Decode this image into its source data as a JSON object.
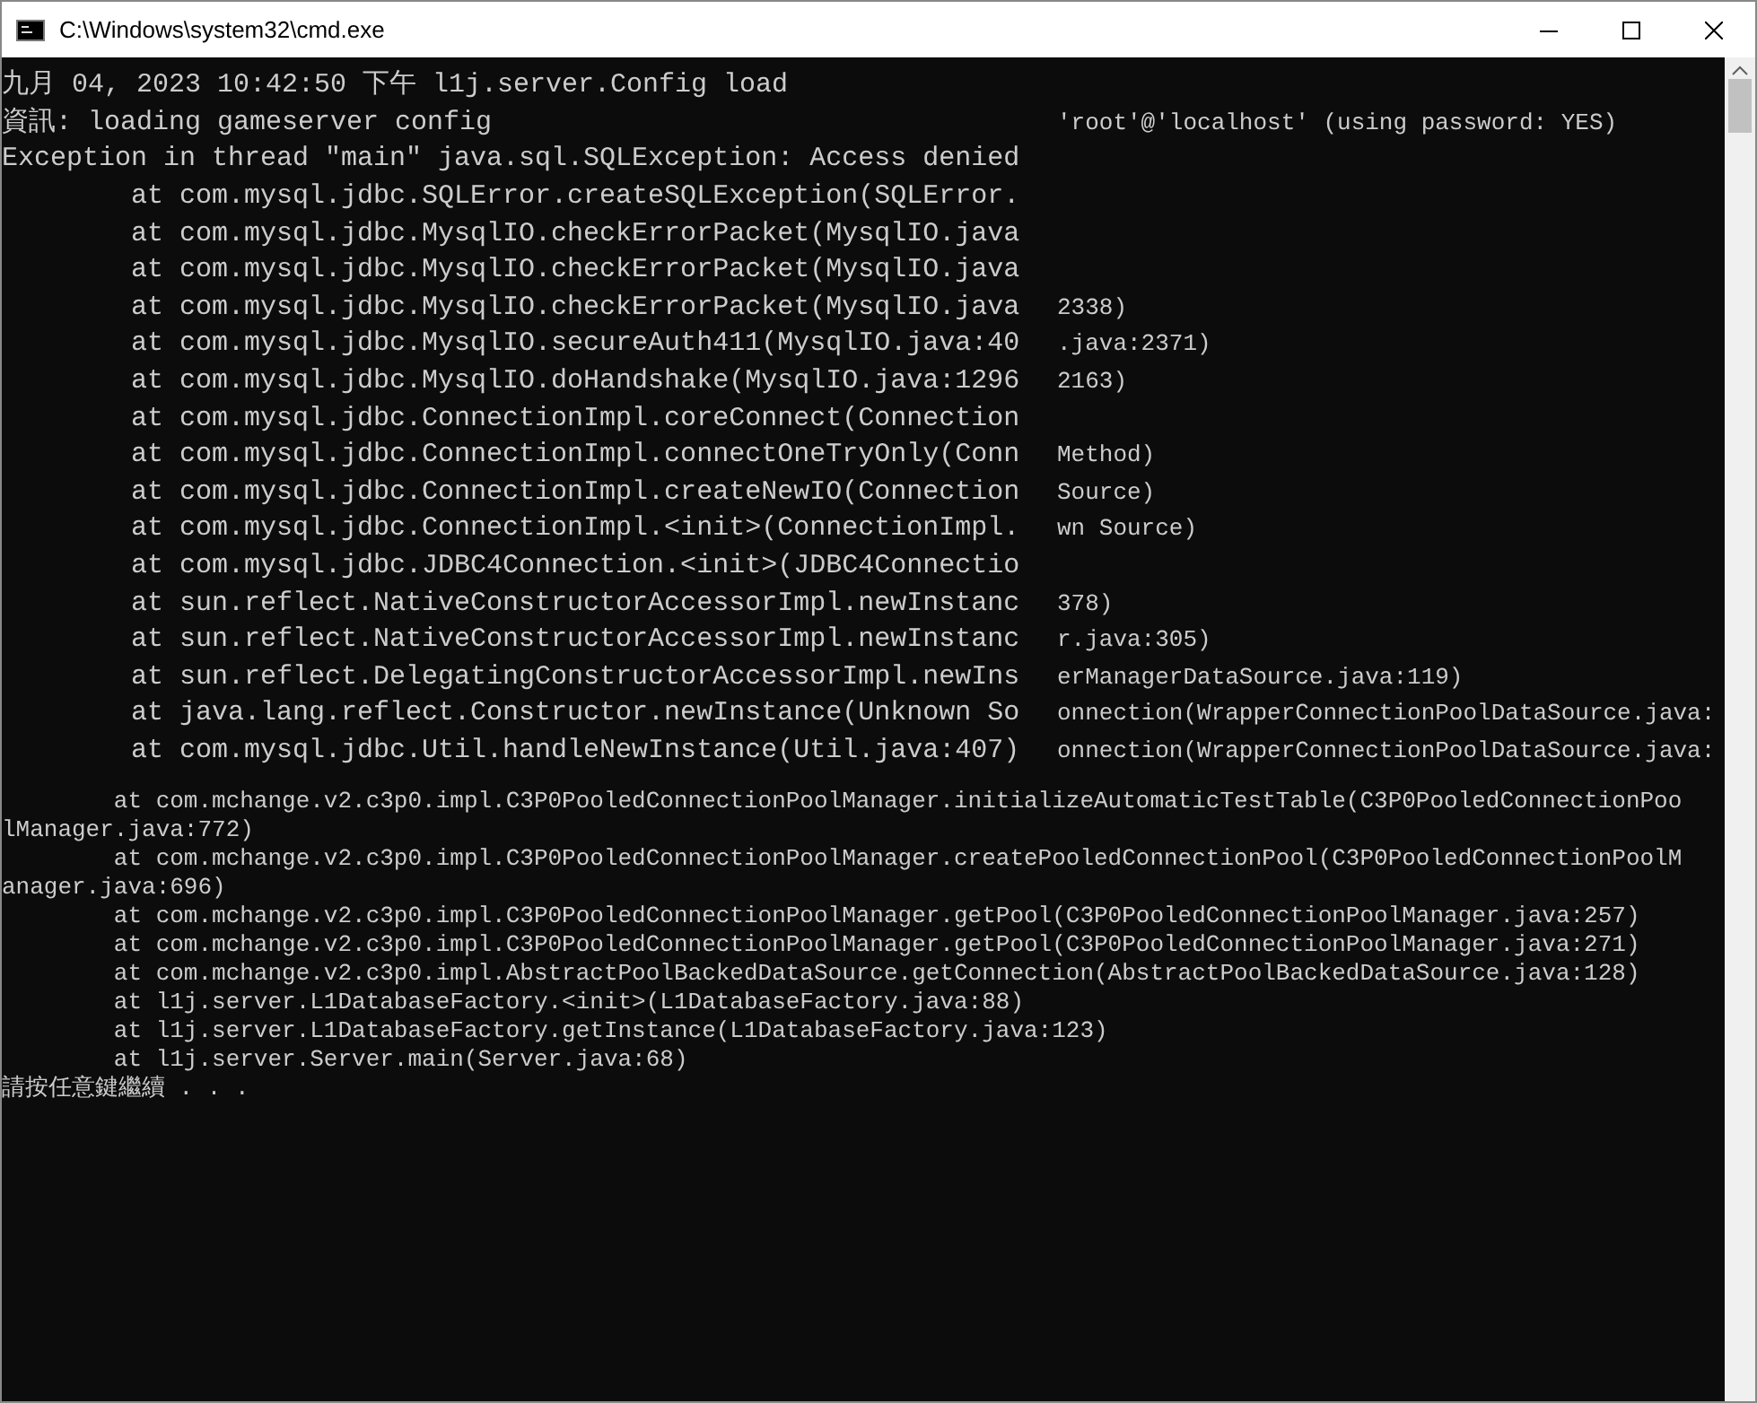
{
  "window": {
    "title": "C:\\Windows\\system32\\cmd.exe"
  },
  "magnified_lines": [
    {
      "text": "九月 04, 2023 10:42:50 下午 l1j.server.Config load"
    },
    {
      "text": "資訊: loading gameserver config",
      "tail": "'root'@'localhost' (using password: YES)"
    },
    {
      "text": "Exception in thread \"main\" java.sql.SQLException: Access denied"
    },
    {
      "text": "        at com.mysql.jdbc.SQLError.createSQLException(SQLError."
    },
    {
      "text": "        at com.mysql.jdbc.MysqlIO.checkErrorPacket(MysqlIO.java"
    },
    {
      "text": "        at com.mysql.jdbc.MysqlIO.checkErrorPacket(MysqlIO.java"
    },
    {
      "text": "        at com.mysql.jdbc.MysqlIO.checkErrorPacket(MysqlIO.java",
      "tail": "2338)"
    },
    {
      "text": "        at com.mysql.jdbc.MysqlIO.secureAuth411(MysqlIO.java:40",
      "tail": ".java:2371)"
    },
    {
      "text": "        at com.mysql.jdbc.MysqlIO.doHandshake(MysqlIO.java:1296",
      "tail": "2163)"
    },
    {
      "text": "        at com.mysql.jdbc.ConnectionImpl.coreConnect(Connection"
    },
    {
      "text": "        at com.mysql.jdbc.ConnectionImpl.connectOneTryOnly(Conn",
      "tail": "Method)"
    },
    {
      "text": "        at com.mysql.jdbc.ConnectionImpl.createNewIO(Connection",
      "tail": "Source)"
    },
    {
      "text": "        at com.mysql.jdbc.ConnectionImpl.<init>(ConnectionImpl.",
      "tail": "wn Source)"
    },
    {
      "text": "        at com.mysql.jdbc.JDBC4Connection.<init>(JDBC4Connectio"
    },
    {
      "text": "        at sun.reflect.NativeConstructorAccessorImpl.newInstanc",
      "tail": "378)"
    },
    {
      "text": "        at sun.reflect.NativeConstructorAccessorImpl.newInstanc",
      "tail": "r.java:305)"
    },
    {
      "text": "        at sun.reflect.DelegatingConstructorAccessorImpl.newIns",
      "tail": "erManagerDataSource.java:119)"
    },
    {
      "text": "        at java.lang.reflect.Constructor.newInstance(Unknown So",
      "tail": "onnection(WrapperConnectionPoolDataSource.java:"
    },
    {
      "text": "        at com.mysql.jdbc.Util.handleNewInstance(Util.java:407)",
      "tail": "onnection(WrapperConnectionPoolDataSource.java:"
    }
  ],
  "lines": [
    "        at com.mchange.v2.c3p0.impl.C3P0PooledConnectionPoolManager.initializeAutomaticTestTable(C3P0PooledConnectionPoo",
    "lManager.java:772)",
    "        at com.mchange.v2.c3p0.impl.C3P0PooledConnectionPoolManager.createPooledConnectionPool(C3P0PooledConnectionPoolM",
    "anager.java:696)",
    "        at com.mchange.v2.c3p0.impl.C3P0PooledConnectionPoolManager.getPool(C3P0PooledConnectionPoolManager.java:257)",
    "        at com.mchange.v2.c3p0.impl.C3P0PooledConnectionPoolManager.getPool(C3P0PooledConnectionPoolManager.java:271)",
    "        at com.mchange.v2.c3p0.impl.AbstractPoolBackedDataSource.getConnection(AbstractPoolBackedDataSource.java:128)",
    "        at l1j.server.L1DatabaseFactory.<init>(L1DatabaseFactory.java:88)",
    "        at l1j.server.L1DatabaseFactory.getInstance(L1DatabaseFactory.java:123)",
    "        at l1j.server.Server.main(Server.java:68)",
    "請按任意鍵繼續 . . ."
  ]
}
